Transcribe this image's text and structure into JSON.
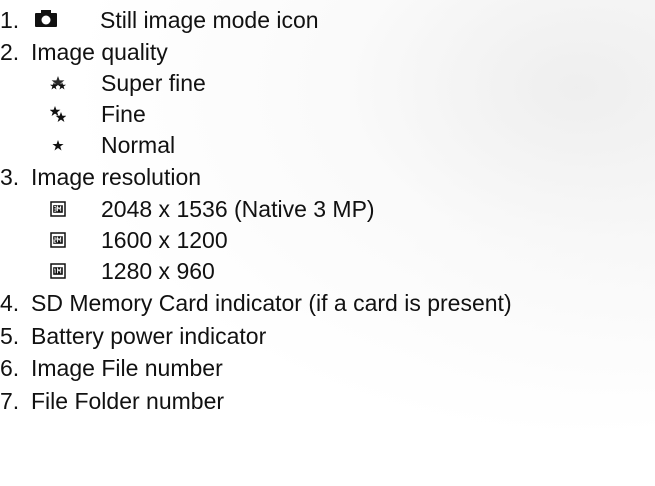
{
  "items": [
    {
      "number": "1.",
      "icon": "camera-icon",
      "label": "Still image mode icon"
    },
    {
      "number": "2.",
      "label": "Image quality",
      "sub_items": [
        {
          "icon": "super-fine-icon",
          "label": "Super fine"
        },
        {
          "icon": "fine-icon",
          "label": "Fine"
        },
        {
          "icon": "normal-icon",
          "label": "Normal"
        }
      ]
    },
    {
      "number": "3.",
      "label": "Image resolution",
      "sub_items": [
        {
          "icon": "resolution-3m-icon",
          "label": "2048 x 1536 (Native 3 MP)"
        },
        {
          "icon": "resolution-2m-icon",
          "label": "1600 x 1200"
        },
        {
          "icon": "resolution-1m-icon",
          "label": "1280 x 960"
        }
      ]
    },
    {
      "number": "4.",
      "label": "SD Memory Card indicator (if a card is present)"
    },
    {
      "number": "5.",
      "label": "Battery power indicator"
    },
    {
      "number": "6.",
      "label": "Image File number"
    },
    {
      "number": "7.",
      "label": "File Folder number"
    }
  ]
}
